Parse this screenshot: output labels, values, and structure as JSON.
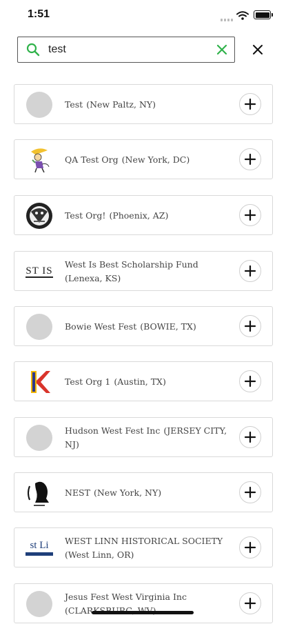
{
  "status_bar": {
    "time": "1:51"
  },
  "search": {
    "value": "test"
  },
  "colors": {
    "accent": "#2fb24a",
    "border": "#d9d9d9",
    "placeholder_logo": "#d3d3d3"
  },
  "results": [
    {
      "name": "Test",
      "location": "(New Paltz, NY)",
      "logo": "placeholder-logo"
    },
    {
      "name": "QA Test Org",
      "location": "(New York, DC)",
      "logo": "cartoon-character-logo"
    },
    {
      "name": "Test Org!",
      "location": "(Phoenix, AZ)",
      "logo": "circular-artwork-logo"
    },
    {
      "name": "West Is Best Scholarship Fund",
      "location": "(Lenexa, KS)",
      "logo": "text-logo",
      "logo_text": "ST IS"
    },
    {
      "name": "Bowie West Fest",
      "location": "(BOWIE, TX)",
      "logo": "placeholder-logo"
    },
    {
      "name": "Test Org 1",
      "location": "(Austin, TX)",
      "logo": "letter-k-logo"
    },
    {
      "name": "Hudson West Fest Inc",
      "location": "(JERSEY CITY, NJ)",
      "logo": "placeholder-logo"
    },
    {
      "name": "NEST",
      "location": "(New York, NY)",
      "logo": "silhouette-logo"
    },
    {
      "name": "WEST LINN HISTORICAL SOCIETY",
      "location": "(West Linn, OR)",
      "logo": "text-logo",
      "logo_text": "st Li"
    },
    {
      "name": "Jesus Fest West Virginia Inc",
      "location": "(CLARKSBURG, WV)",
      "logo": "placeholder-logo"
    }
  ]
}
